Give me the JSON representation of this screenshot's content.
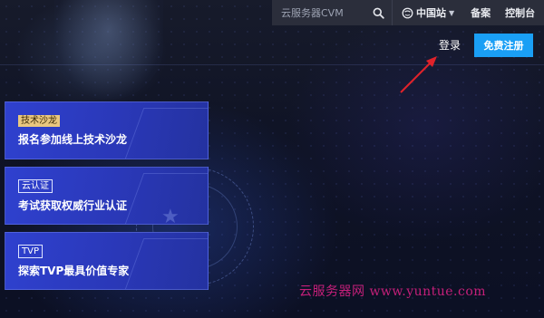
{
  "topbar": {
    "search_placeholder": "云服务器CVM",
    "region_label": "中国站",
    "nav_beian": "备案",
    "nav_console": "控制台"
  },
  "auth": {
    "login_label": "登录",
    "register_label": "免费注册"
  },
  "cards": [
    {
      "tag": "技术沙龙",
      "title": "报名参加线上技术沙龙"
    },
    {
      "tag": "云认证",
      "title": "考试获取权威行业认证"
    },
    {
      "tag": "TVP",
      "title": "探索TVP最具价值专家"
    }
  ],
  "watermark": "云服务器网 www.yuntue.com",
  "colors": {
    "topbar_bg": "#2b2e3b",
    "register_bg": "#1a9ff5",
    "card_bg": "#2f41cf",
    "tag_gold": "#e9c77f",
    "arrow": "#e0222a",
    "watermark": "#c51f7a"
  }
}
